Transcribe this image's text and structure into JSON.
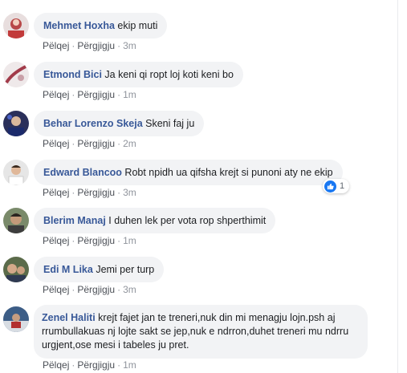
{
  "actions": {
    "like": "Pëlqej",
    "reply": "Përgjigju",
    "sep": "·"
  },
  "comments": [
    {
      "author": "Mehmet Hoxha",
      "text": "ekip muti",
      "time": "3m"
    },
    {
      "author": "Etmond Bici",
      "text": "Ja keni qi ropt loj koti keni bo",
      "time": "1m"
    },
    {
      "author": "Behar Lorenzo Skeja",
      "text": "Skeni faj ju",
      "time": "2m"
    },
    {
      "author": "Edward Blancoo",
      "text": "Robt npidh ua qifsha krejt si punoni aty ne ekip",
      "time": "3m",
      "reactions": "1"
    },
    {
      "author": "Blerim Manaj",
      "text": "I duhen lek per vota rop shperthimit",
      "time": "1m"
    },
    {
      "author": "Edi M Lika",
      "text": "Jemi per turp",
      "time": "3m"
    },
    {
      "author": "Zenel Haliti",
      "text": "krejt fajet jan te treneri,nuk din mi menagju lojn.psh aj rrumbullakuas nj lojte sakt se jep,nuk e ndrron,duhet treneri mu ndrru urgjent,ose mesi i tabeles ju pret.",
      "time": "1m"
    }
  ],
  "colors": {
    "author": "#385898",
    "bubble": "#f2f3f5",
    "like_blue": "#1877f2"
  }
}
